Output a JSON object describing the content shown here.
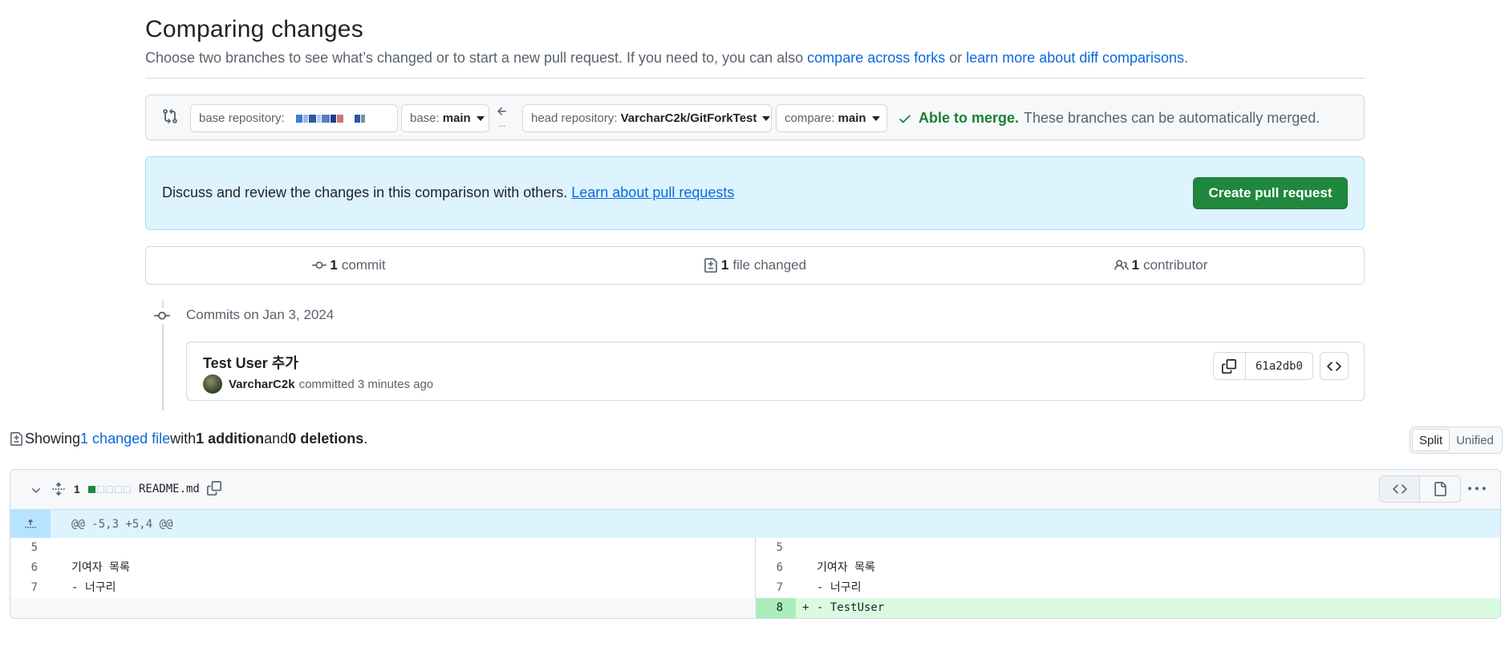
{
  "header": {
    "title": "Comparing changes",
    "description": "Choose two branches to see what’s changed or to start a new pull request. If you need to, you can also ",
    "link_forks": "compare across forks",
    "or_text": " or ",
    "link_learn": "learn more about diff comparisons",
    "period": "."
  },
  "range": {
    "base_repo_label": "base repository:",
    "base_label": "base:",
    "base_value": "main",
    "head_repo_label": "head repository:",
    "head_repo_value": "VarcharC2k/GitForkTest",
    "compare_label": "compare:",
    "compare_value": "main",
    "merge_ok": "Able to merge.",
    "merge_note": "These branches can be automatically merged.",
    "arrow_dots": "..."
  },
  "discuss": {
    "text": "Discuss and review the changes in this comparison with others. ",
    "link": "Learn about pull requests",
    "create_button": "Create pull request"
  },
  "summary": {
    "commits_count": "1",
    "commits_label": "commit",
    "files_count": "1",
    "files_label": "file changed",
    "contributors_count": "1",
    "contributors_label": "contributor"
  },
  "commits": {
    "date_heading": "Commits on Jan 3, 2024",
    "items": [
      {
        "title": "Test User 추가",
        "author": "VarcharC2k",
        "meta": "committed 3 minutes ago",
        "sha": "61a2db0"
      }
    ]
  },
  "toc": {
    "showing": "Showing ",
    "changed_link": "1 changed file",
    "with": " with ",
    "additions": "1 addition",
    "and": " and ",
    "deletions": "0 deletions",
    "period": "."
  },
  "view_toggle": {
    "split": "Split",
    "unified": "Unified",
    "selected": "Split"
  },
  "file": {
    "change_count": "1",
    "name": "README.md",
    "hunk_header": "@@ -5,3 +5,4 @@",
    "rows": [
      {
        "left_ln": "5",
        "left_code": "",
        "right_ln": "5",
        "right_code": ""
      },
      {
        "left_ln": "6",
        "left_code": "기여자 목록",
        "right_ln": "6",
        "right_code": "기여자 목록"
      },
      {
        "left_ln": "7",
        "left_code": "- 너구리",
        "right_ln": "7",
        "right_code": "- 너구리"
      }
    ],
    "added_row": {
      "right_ln": "8",
      "marker": "+",
      "right_code": "- TestUser"
    }
  },
  "colors": {
    "accent_link": "#0969da",
    "success_green": "#1a7f37",
    "button_green": "#1f883d",
    "info_bg": "#ddf4ff",
    "addition_bg": "#dafbe1"
  },
  "icons": [
    "git-compare-icon",
    "arrow-left-icon",
    "check-icon",
    "git-commit-icon",
    "file-diff-icon",
    "people-icon",
    "copy-icon",
    "code-icon",
    "chevron-down-icon",
    "unfold-icon",
    "file-icon",
    "kebab-horizontal-icon",
    "fold-up-icon"
  ]
}
